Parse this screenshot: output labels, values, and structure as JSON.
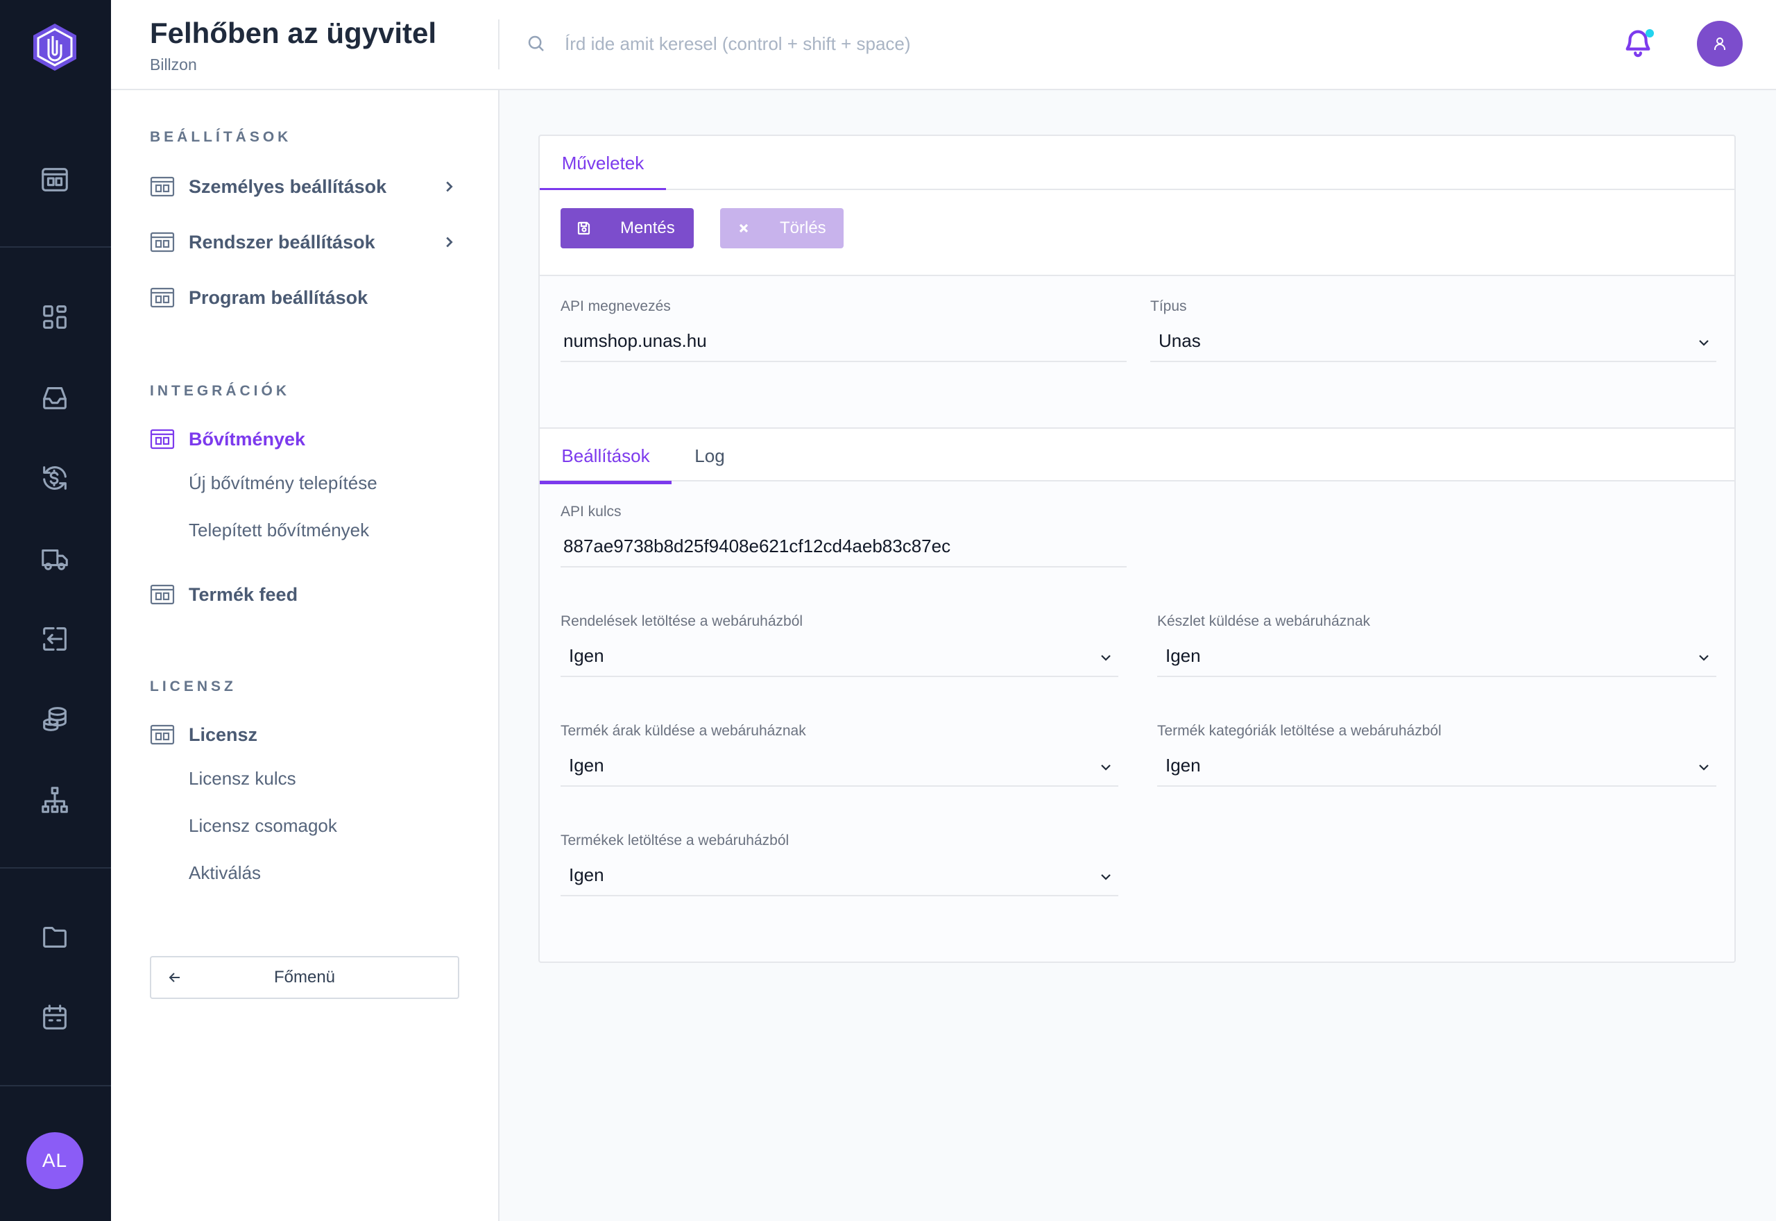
{
  "header": {
    "title": "Felhőben az ügyvitel",
    "subtitle": "Billzon",
    "search_placeholder": "Írd ide amit keresel (control + shift + space)"
  },
  "rail": {
    "icons": [
      "layout-icon",
      "apps-grid-icon",
      "inbox-icon",
      "currency-exchange-icon",
      "truck-icon",
      "transfer-in-icon",
      "coins-icon",
      "sitemap-icon",
      "folder-icon",
      "calendar-icon"
    ],
    "avatar_initials": "AL"
  },
  "sidebar": {
    "sections": {
      "settings": "BEÁLLÍTÁSOK",
      "integrations": "INTEGRÁCIÓK",
      "license": "LICENSZ"
    },
    "items": {
      "personal": "Személyes beállítások",
      "system": "Rendszer beállítások",
      "program": "Program beállítások",
      "extensions": "Bővítmények",
      "new_extension": "Új bővítmény telepítése",
      "installed_extensions": "Telepített bővítmények",
      "product_feed": "Termék feed",
      "license": "Licensz",
      "license_key": "Licensz kulcs",
      "license_packages": "Licensz csomagok",
      "activation": "Aktiválás"
    },
    "main_menu": "Főmenü"
  },
  "card": {
    "tab_actions": "Műveletek",
    "save": "Mentés",
    "delete": "Törlés",
    "api_name_label": "API megnevezés",
    "api_name_value": "numshop.unas.hu",
    "type_label": "Típus",
    "type_value": "Unas",
    "tab_settings": "Beállítások",
    "tab_log": "Log",
    "api_key_label": "API kulcs",
    "api_key_value": "887ae9738b8d25f9408e621cf12cd4aeb83c87ec",
    "fields": {
      "orders_download_label": "Rendelések letöltése a webáruházból",
      "orders_download_value": "Igen",
      "stock_send_label": "Készlet küldése a webáruháznak",
      "stock_send_value": "Igen",
      "prices_send_label": "Termék árak küldése a webáruháznak",
      "prices_send_value": "Igen",
      "categories_download_label": "Termék kategóriák letöltése a webáruházból",
      "categories_download_value": "Igen",
      "products_download_label": "Termékek letöltése a webáruházból",
      "products_download_value": "Igen"
    }
  },
  "colors": {
    "accent": "#7c3aed",
    "rail_bg": "#111827",
    "save_button": "#7c4dcc",
    "delete_button": "#c8b3ec"
  }
}
